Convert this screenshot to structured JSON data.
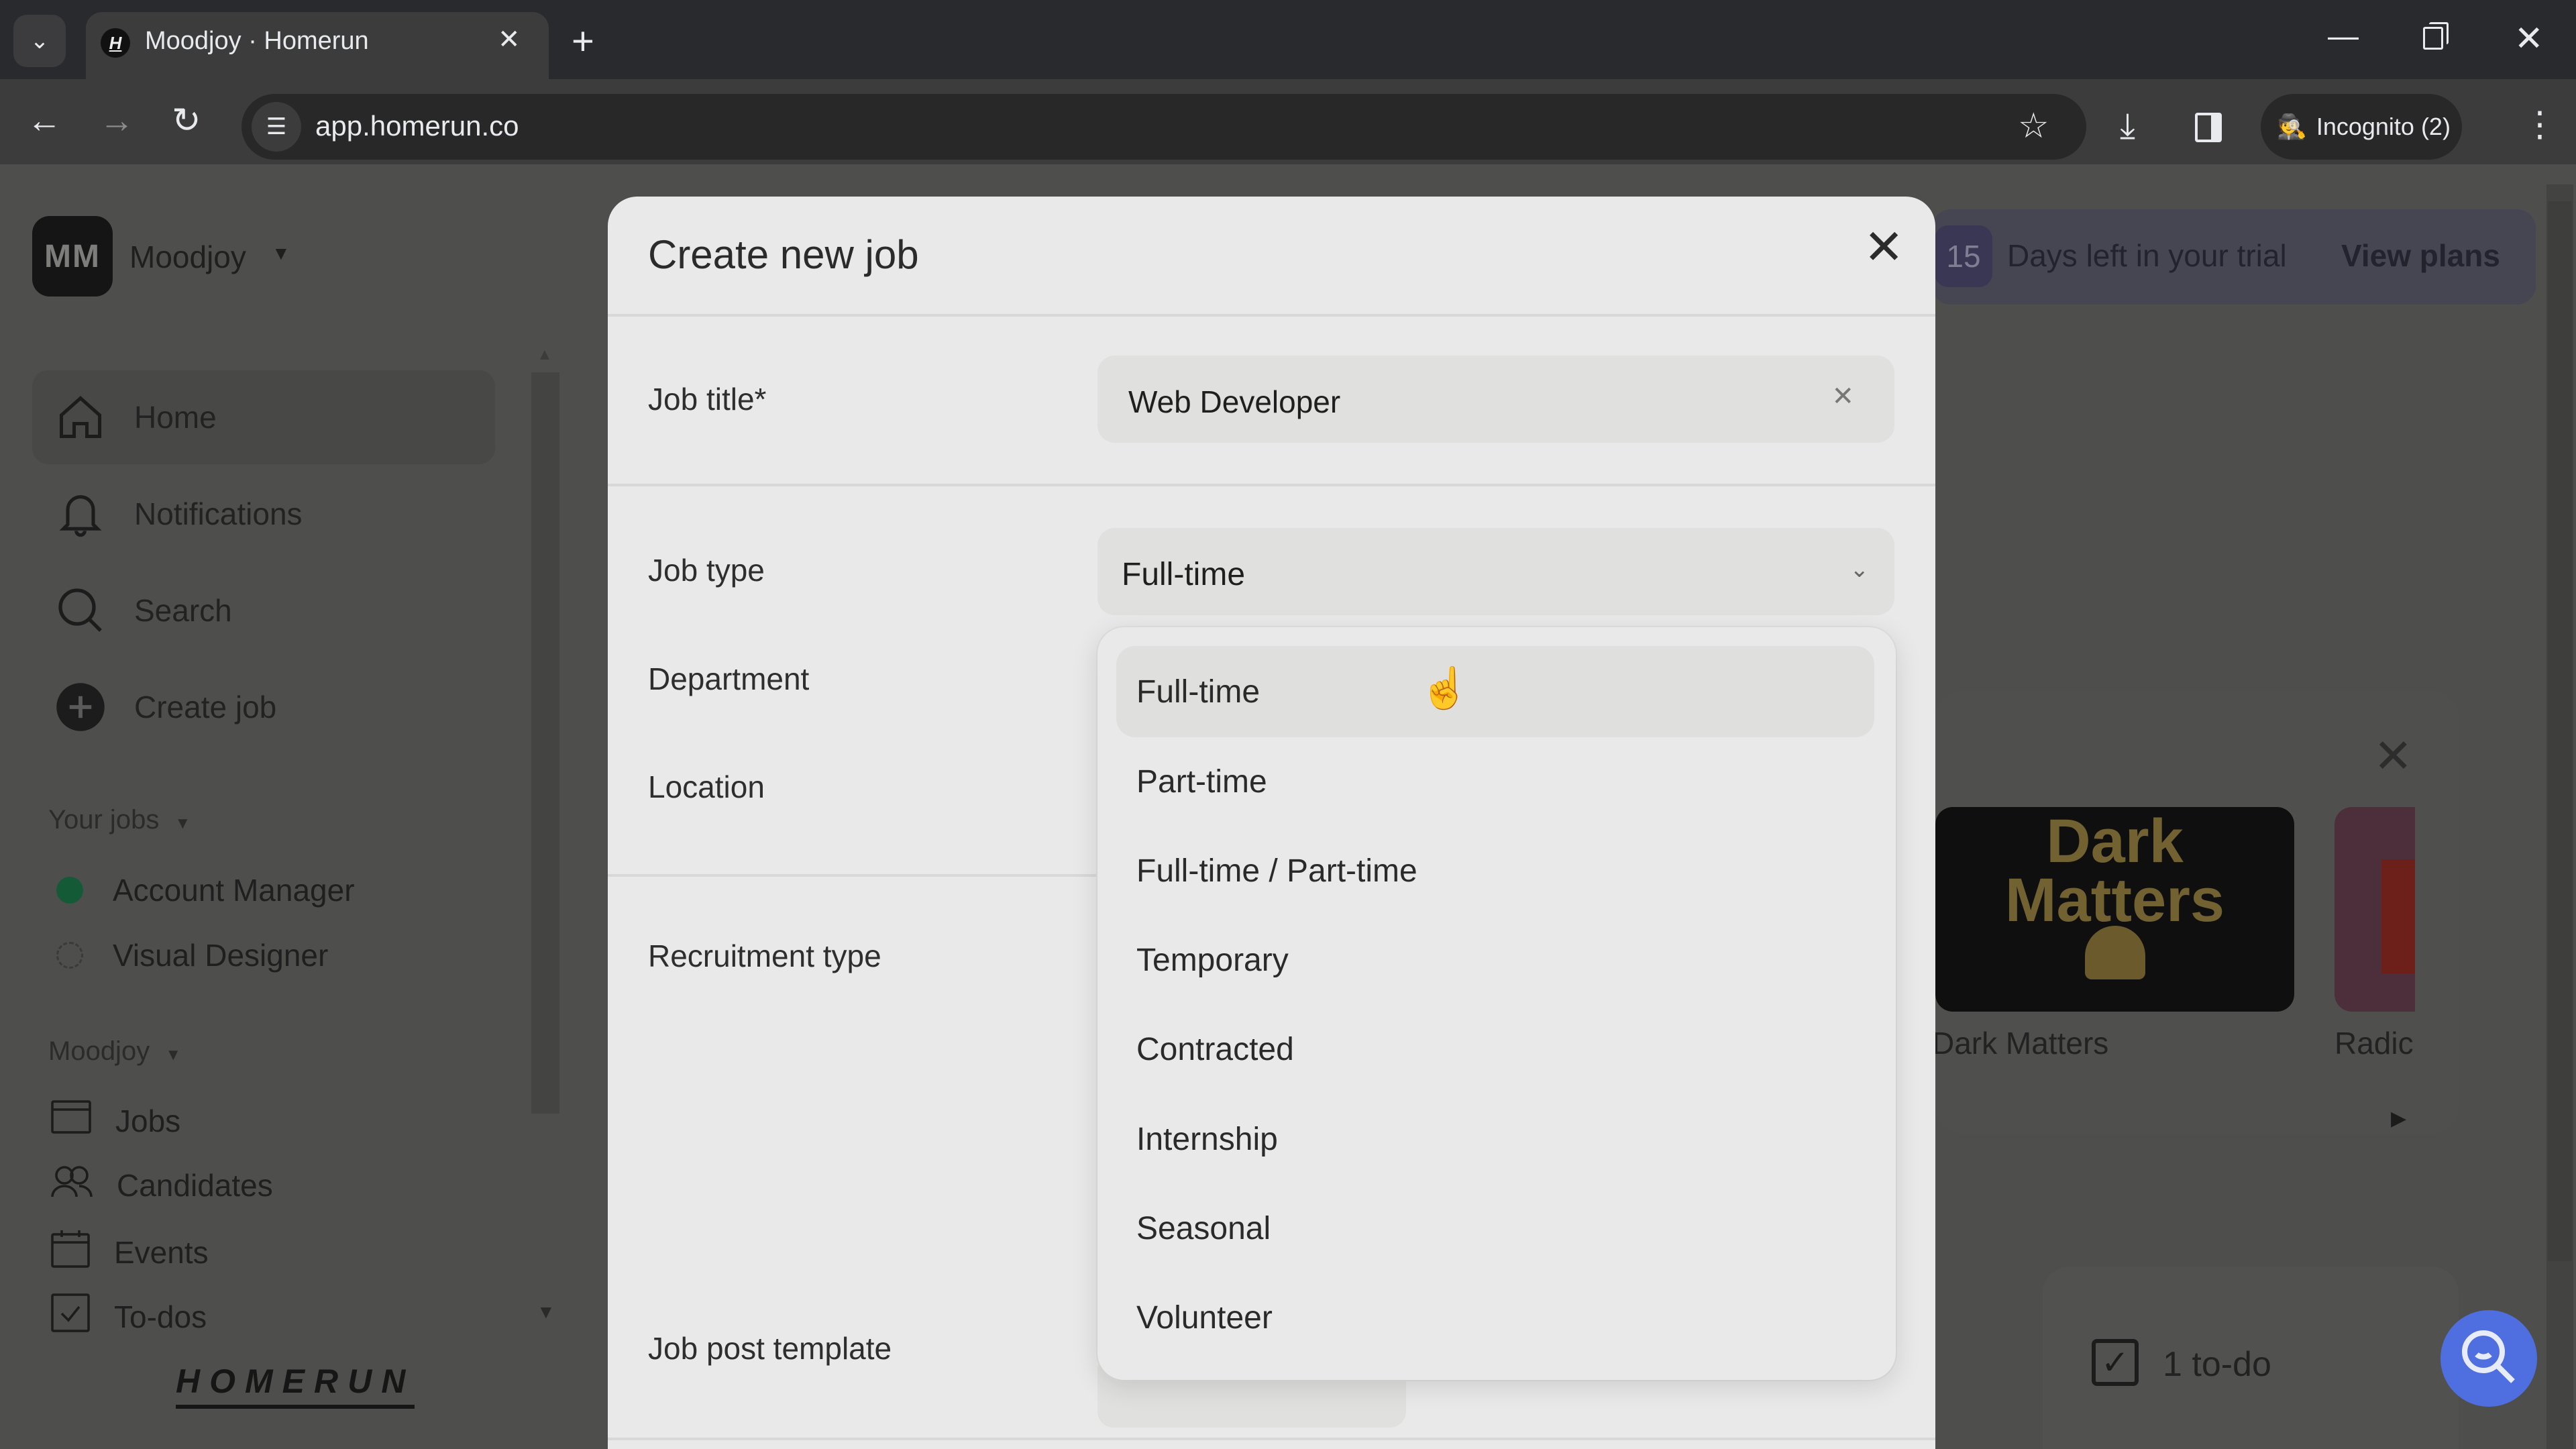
{
  "browser": {
    "tab_title": "Moodjoy · Homerun",
    "tab_favicon": "H",
    "url": "app.homerun.co",
    "incognito_label": "Incognito (2)",
    "icons": {
      "tab_search": "chevron-down-icon",
      "new_tab": "plus-icon",
      "back": "arrow-left-icon",
      "forward": "arrow-right-icon",
      "reload": "reload-icon",
      "site_info": "tune-icon",
      "bookmark": "star-icon",
      "download": "download-icon",
      "side_panel": "side-panel-icon",
      "incognito": "incognito-icon",
      "menu": "kebab-icon"
    }
  },
  "sidebar": {
    "org_initials": "MM",
    "org_name": "Moodjoy",
    "nav": [
      {
        "label": "Home",
        "icon": "home-icon",
        "active": true
      },
      {
        "label": "Notifications",
        "icon": "bell-icon"
      },
      {
        "label": "Search",
        "icon": "search-icon"
      },
      {
        "label": "Create job",
        "icon": "plus-circle-icon"
      }
    ],
    "your_jobs_header": "Your jobs",
    "your_jobs": [
      {
        "label": "Account Manager",
        "status": "published"
      },
      {
        "label": "Visual Designer",
        "status": "draft"
      }
    ],
    "org_section_header": "Moodjoy",
    "org_items": [
      {
        "label": "Jobs",
        "icon": "jobs-icon"
      },
      {
        "label": "Candidates",
        "icon": "candidates-icon"
      },
      {
        "label": "Events",
        "icon": "calendar-icon"
      },
      {
        "label": "To-dos",
        "icon": "checkbox-icon"
      }
    ],
    "brand_logo": "HOMERUN"
  },
  "background": {
    "trial_days": "15",
    "trial_text": "Days left in your trial",
    "view_plans": "View plans",
    "podcasts": [
      {
        "title": "Dark Matters",
        "art_text": "Dark Matters"
      },
      {
        "title": "Radic"
      }
    ],
    "todo_count_label": "1 to-do"
  },
  "modal": {
    "title": "Create new job",
    "fields": {
      "job_title_label": "Job title*",
      "job_title_value": "Web Developer",
      "job_type_label": "Job type",
      "job_type_value": "Full-time",
      "department_label": "Department",
      "location_label": "Location",
      "recruitment_type_label": "Recruitment type",
      "job_post_template_label": "Job post template"
    },
    "job_type_options": [
      {
        "label": "Full-time",
        "hovered": true
      },
      {
        "label": "Part-time"
      },
      {
        "label": "Full-time / Part-time"
      },
      {
        "label": "Temporary"
      },
      {
        "label": "Contracted"
      },
      {
        "label": "Internship"
      },
      {
        "label": "Seasonal"
      },
      {
        "label": "Volunteer"
      }
    ]
  },
  "colors": {
    "accent_blue": "#4f6fe0",
    "published_green": "#145a37"
  }
}
